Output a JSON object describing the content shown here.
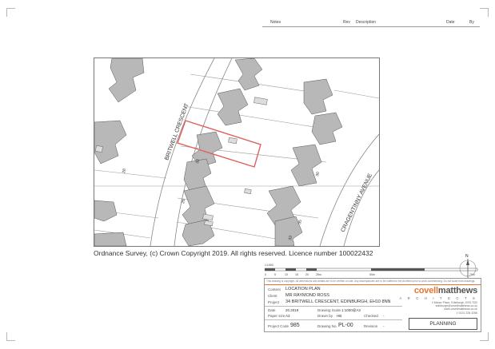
{
  "revision_table": {
    "headers": [
      "Notes",
      "Rev",
      "Description",
      "Date",
      "By"
    ]
  },
  "map": {
    "street_labels": [
      "BRITWELL CRESCENT",
      "CRAGENTINNY AVENUE"
    ],
    "house_numbers": [
      "28",
      "32",
      "26",
      "30",
      "35",
      "33"
    ],
    "site_outline_color": "#e06060",
    "building_color": "#b8b8b8"
  },
  "copyright": "Ordnance Survey, (c) Crown Copyright 2019. All rights reserved. Licence number 100022432",
  "scale_bar": {
    "ticks": [
      "0",
      "5",
      "10",
      "15",
      "20",
      "25m",
      "50m",
      "75m"
    ],
    "label": "1:1000"
  },
  "north_arrow": {
    "label": "N"
  },
  "title_block": {
    "disclaimer": "This drawing is copyright. All dimensions and details are to be verified on site. Any discrepancies are to be notified to the Architect prior to work commencing. Do not scale from drawings.",
    "content_label": "Content",
    "content_value": "LOCATION PLAN",
    "client_label": "Client",
    "client_value": "MR RAYMOND ROSS",
    "project_label": "Project",
    "project_value": "34 BRITWELL CRESCENT, EDINBURGH, EH10 8NN",
    "date_label": "Date",
    "date_value": "20.2019",
    "drawing_scale_label": "Drawing Scale",
    "drawing_scale_value": "1:1000@A3",
    "paper_size_label": "Paper size",
    "paper_size_value": "A3",
    "drawn_by_label": "Drawn by",
    "drawn_by_value": "HB",
    "checked_label": "Checked",
    "checked_value": "-",
    "project_code_label": "Project Code",
    "project_code_value": "985",
    "drawing_no_label": "Drawing No.",
    "drawing_no_value": "PL-00",
    "revision_label": "Revision",
    "revision_value": "-",
    "status": "PLANNING"
  },
  "logo": {
    "name_part1": "covell",
    "name_part2": "matthews",
    "subtitle": "A R C H I T E C T S",
    "address_lines": [
      "4 Manor Place, Edinburgh, EH3 7DD",
      "edinburgh@covellmatthews.co.uk",
      "www.covellmatthews.co.uk",
      "t: 0131 226 3266"
    ]
  }
}
